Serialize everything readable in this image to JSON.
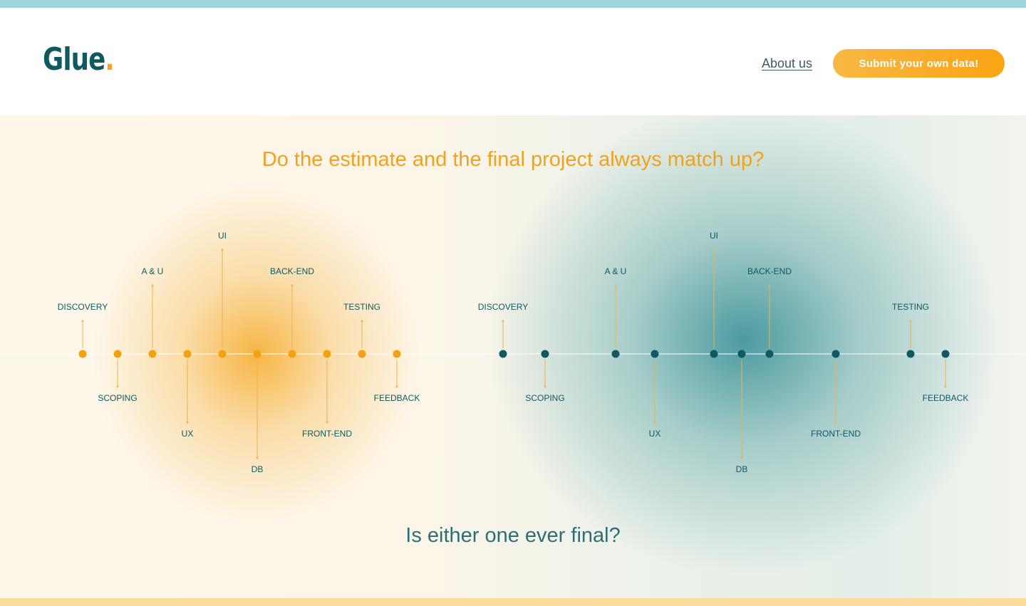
{
  "header": {
    "logo_text": "Glue",
    "logo_dot": ".",
    "about_label": "About us",
    "cta_label": "Submit your own data!"
  },
  "hero": {
    "title": "Do the estimate and the final project always match up?",
    "subtitle": "Is either one ever final?"
  },
  "colors": {
    "estimate": "#f5a00f",
    "final": "#0f5961",
    "stem": "#efb24a",
    "accent_top": "#9dd6de",
    "accent_bottom": "#fbdc9c"
  },
  "timelines": [
    {
      "id": "estimate",
      "color": "#f5a00f",
      "stages": [
        {
          "label": "DISCOVERY",
          "pos": 116,
          "side": "up",
          "level": 1
        },
        {
          "label": "SCOPING",
          "pos": 165,
          "side": "down",
          "level": 1
        },
        {
          "label": "A & U",
          "pos": 214,
          "side": "up",
          "level": 2
        },
        {
          "label": "UX",
          "pos": 263,
          "side": "down",
          "level": 2
        },
        {
          "label": "UI",
          "pos": 312,
          "side": "up",
          "level": 3
        },
        {
          "label": "DB",
          "pos": 361,
          "side": "down",
          "level": 3
        },
        {
          "label": "BACK-END",
          "pos": 410,
          "side": "up",
          "level": 2
        },
        {
          "label": "FRONT-END",
          "pos": 459,
          "side": "down",
          "level": 2
        },
        {
          "label": "TESTING",
          "pos": 508,
          "side": "up",
          "level": 1
        },
        {
          "label": "FEEDBACK",
          "pos": 557,
          "side": "down",
          "level": 1
        }
      ]
    },
    {
      "id": "final",
      "color": "#0f5961",
      "stages": [
        {
          "label": "DISCOVERY",
          "pos": 706,
          "side": "up",
          "level": 1
        },
        {
          "label": "SCOPING",
          "pos": 765,
          "side": "down",
          "level": 1
        },
        {
          "label": "A & U",
          "pos": 864,
          "side": "up",
          "level": 2
        },
        {
          "label": "UX",
          "pos": 919,
          "side": "down",
          "level": 2
        },
        {
          "label": "UI",
          "pos": 1002,
          "side": "up",
          "level": 3
        },
        {
          "label": "DB",
          "pos": 1041,
          "side": "down",
          "level": 3
        },
        {
          "label": "BACK-END",
          "pos": 1080,
          "side": "up",
          "level": 2
        },
        {
          "label": "FRONT-END",
          "pos": 1173,
          "side": "down",
          "level": 2
        },
        {
          "label": "TESTING",
          "pos": 1278,
          "side": "up",
          "level": 1
        },
        {
          "label": "FEEDBACK",
          "pos": 1327,
          "side": "down",
          "level": 1
        }
      ]
    }
  ]
}
